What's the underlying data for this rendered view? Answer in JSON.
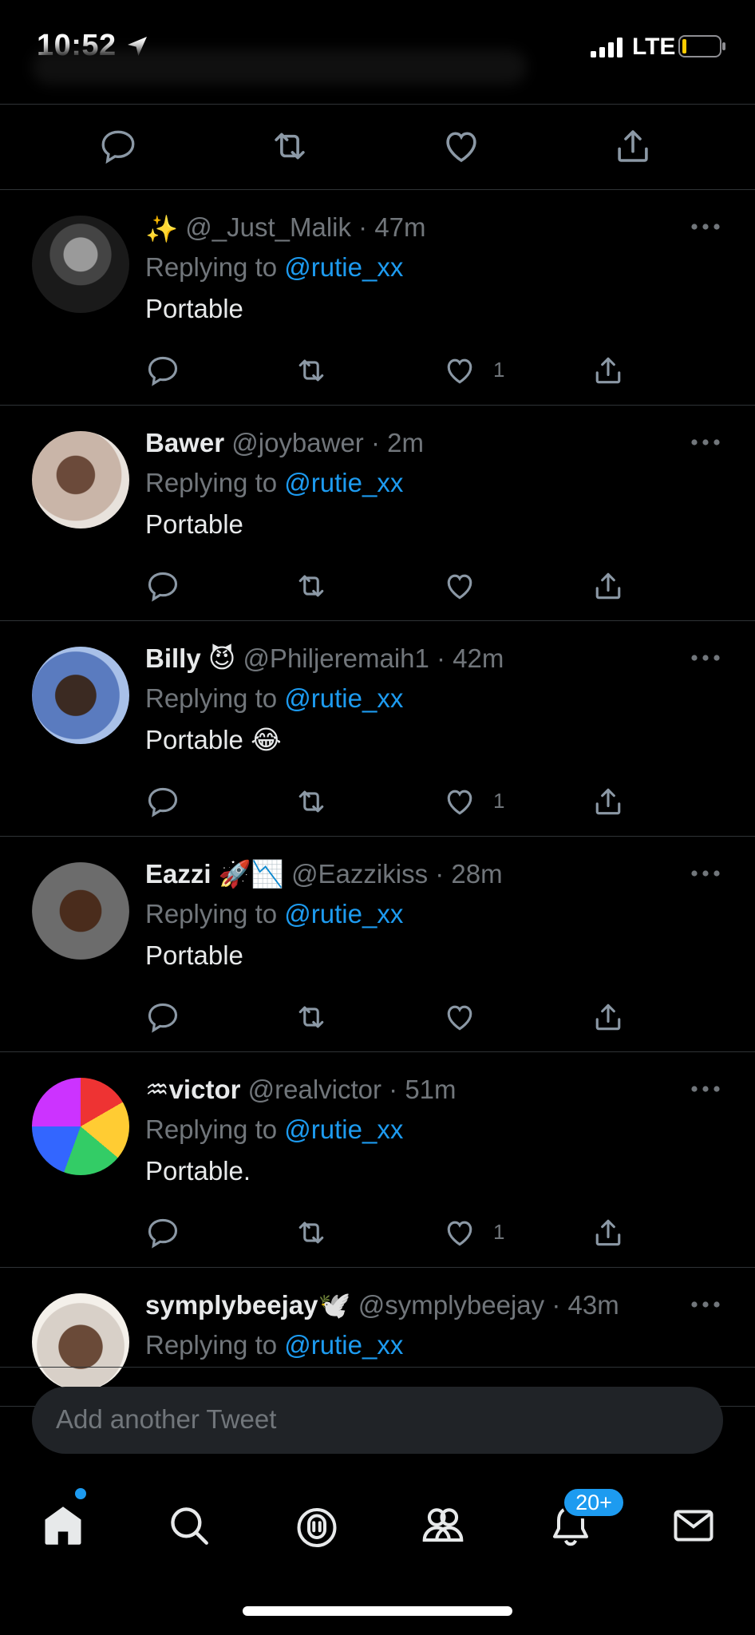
{
  "status_bar": {
    "time": "10:52",
    "network": "LTE"
  },
  "top_actions": [
    "reply-icon",
    "retweet-icon",
    "like-icon",
    "share-icon"
  ],
  "accent_color": "#1d9bf0",
  "tweets": [
    {
      "prefix_emoji": "✨",
      "name": "",
      "handle": "@_Just_Malik",
      "time": "47m",
      "replying_label": "Replying to",
      "mention": "@rutie_xx",
      "text": "Portable",
      "like_count": "1"
    },
    {
      "prefix_emoji": "",
      "name": "Bawer",
      "handle": "@joybawer",
      "time": "2m",
      "replying_label": "Replying to",
      "mention": "@rutie_xx",
      "text": "Portable",
      "like_count": ""
    },
    {
      "prefix_emoji": "",
      "name": "Billy 😈",
      "handle": "@Philjeremaih1",
      "time": "42m",
      "replying_label": "Replying to",
      "mention": "@rutie_xx",
      "text": "Portable 😂",
      "like_count": "1"
    },
    {
      "prefix_emoji": "",
      "name": "Eazzi 🚀📉",
      "handle": "@Eazzikiss",
      "time": "28m",
      "replying_label": "Replying to",
      "mention": "@rutie_xx",
      "text": "Portable",
      "like_count": ""
    },
    {
      "prefix_emoji": "",
      "name": "♒victor",
      "handle": "@realvictor",
      "time": "51m",
      "replying_label": "Replying to",
      "mention": "@rutie_xx",
      "text": "Portable.",
      "like_count": "1"
    },
    {
      "prefix_emoji": "",
      "name": "symplybeejay🕊️",
      "handle": "@symplybeejay",
      "time": "43m",
      "replying_label": "Replying to",
      "mention": "@rutie_xx",
      "text": "",
      "like_count": ""
    }
  ],
  "compose": {
    "placeholder": "Add another Tweet"
  },
  "tabbar": {
    "items": [
      "home-icon",
      "search-icon",
      "spaces-icon",
      "communities-icon",
      "notifications-icon",
      "messages-icon"
    ],
    "notification_badge": "20+"
  }
}
